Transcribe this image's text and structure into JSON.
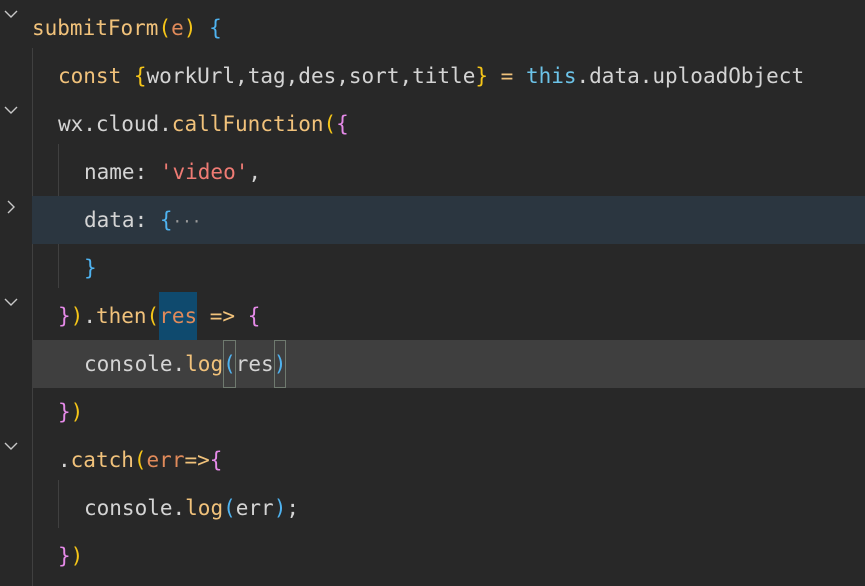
{
  "code": {
    "l1": {
      "fn": "submitForm",
      "p1": "(",
      "param": "e",
      "p2": ")",
      "sp": " ",
      "br": "{"
    },
    "l2": {
      "kw": "const",
      "sp1": " ",
      "bo": "{",
      "v1": "workUrl",
      "c1": ",",
      "v2": "tag",
      "c2": ",",
      "v3": "des",
      "c3": ",",
      "v4": "sort",
      "c4": ",",
      "v5": "title",
      "bc": "}",
      "eq": " = ",
      "this": "this",
      "rest": ".data.uploadObject"
    },
    "l3": {
      "obj": "wx.cloud.",
      "fn": "callFunction",
      "p": "(",
      "b": "{"
    },
    "l4": {
      "key": "name: ",
      "str": "'video'",
      "comma": ","
    },
    "l5": {
      "key": "data: ",
      "b": "{",
      "ellipsis": "···"
    },
    "l6": {
      "b": "}"
    },
    "l7": {
      "b": "}",
      "p": ")",
      "dot": ".",
      "fn": "then",
      "p2": "(",
      "res": "res",
      "arrow": " => ",
      "b2": "{"
    },
    "l8": {
      "obj": "console.",
      "fn": "log",
      "p": "(",
      "arg": "res",
      "pc": ")"
    },
    "l9": {
      "b": "}",
      "p": ")"
    },
    "l10": {
      "dot": ".",
      "fn": "catch",
      "p": "(",
      "arg": "err",
      "arrow": "=>",
      "b": "{"
    },
    "l11": {
      "obj": "console.",
      "fn": "log",
      "p": "(",
      "arg": "err",
      "pc": ")",
      "semi": ";"
    },
    "l12": {
      "b": "}",
      "p": ")"
    }
  },
  "icons": {
    "fold_expanded": "chevron-down-icon",
    "fold_collapsed": "chevron-right-icon"
  },
  "colors": {
    "background": "#282828",
    "keyword": "#f1c27b",
    "string": "#ef7b74",
    "this": "#6cc3e8",
    "selection_line": "#2b3640",
    "current_line": "#3f3f3f"
  }
}
